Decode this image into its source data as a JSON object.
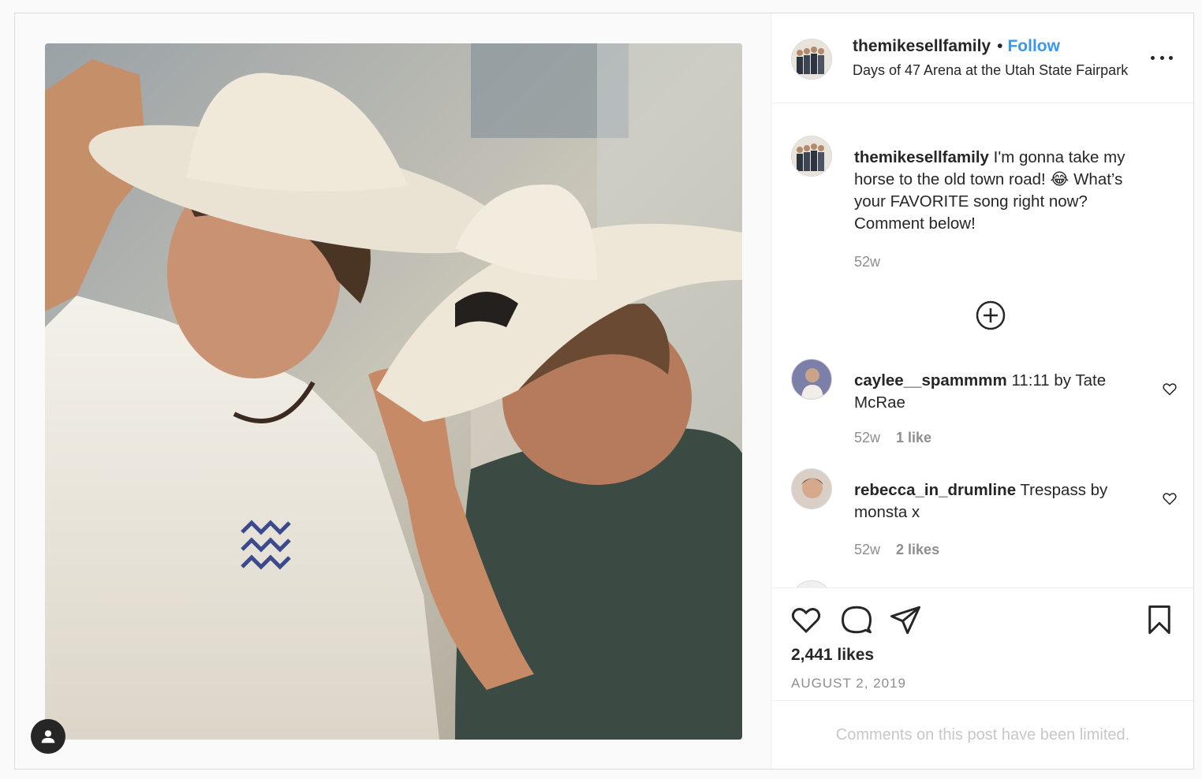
{
  "post": {
    "username": "themikesellfamily",
    "follow_label": "Follow",
    "separator": "•",
    "location": "Days of 47 Arena at the Utah State Fairpark",
    "caption": {
      "username": "themikesellfamily",
      "text": "I'm gonna take my horse to the old town road! 😂 What’s your FAVORITE song right now? Comment below!",
      "time": "52w"
    },
    "comments": [
      {
        "username": "caylee__spammmm",
        "text": "11:11 by Tate McRae",
        "time": "52w",
        "likes": "1 like"
      },
      {
        "username": "rebecca_in_drumline",
        "text": "Trespass by monsta x",
        "time": "52w",
        "likes": "2 likes"
      }
    ],
    "likes_count": "2,441 likes",
    "date": "AUGUST 2, 2019",
    "comments_limited": "Comments on this post have been limited."
  },
  "icons": {
    "more": "more-horizontal-icon",
    "load_more": "plus-circle-icon",
    "like": "heart-icon",
    "comment": "comment-icon",
    "share": "paper-plane-icon",
    "save": "bookmark-icon",
    "tags": "user-tag-icon"
  },
  "colors": {
    "link": "#3897f0",
    "text": "#262626",
    "muted": "#8e8e8e",
    "border": "#dbdbdb"
  }
}
